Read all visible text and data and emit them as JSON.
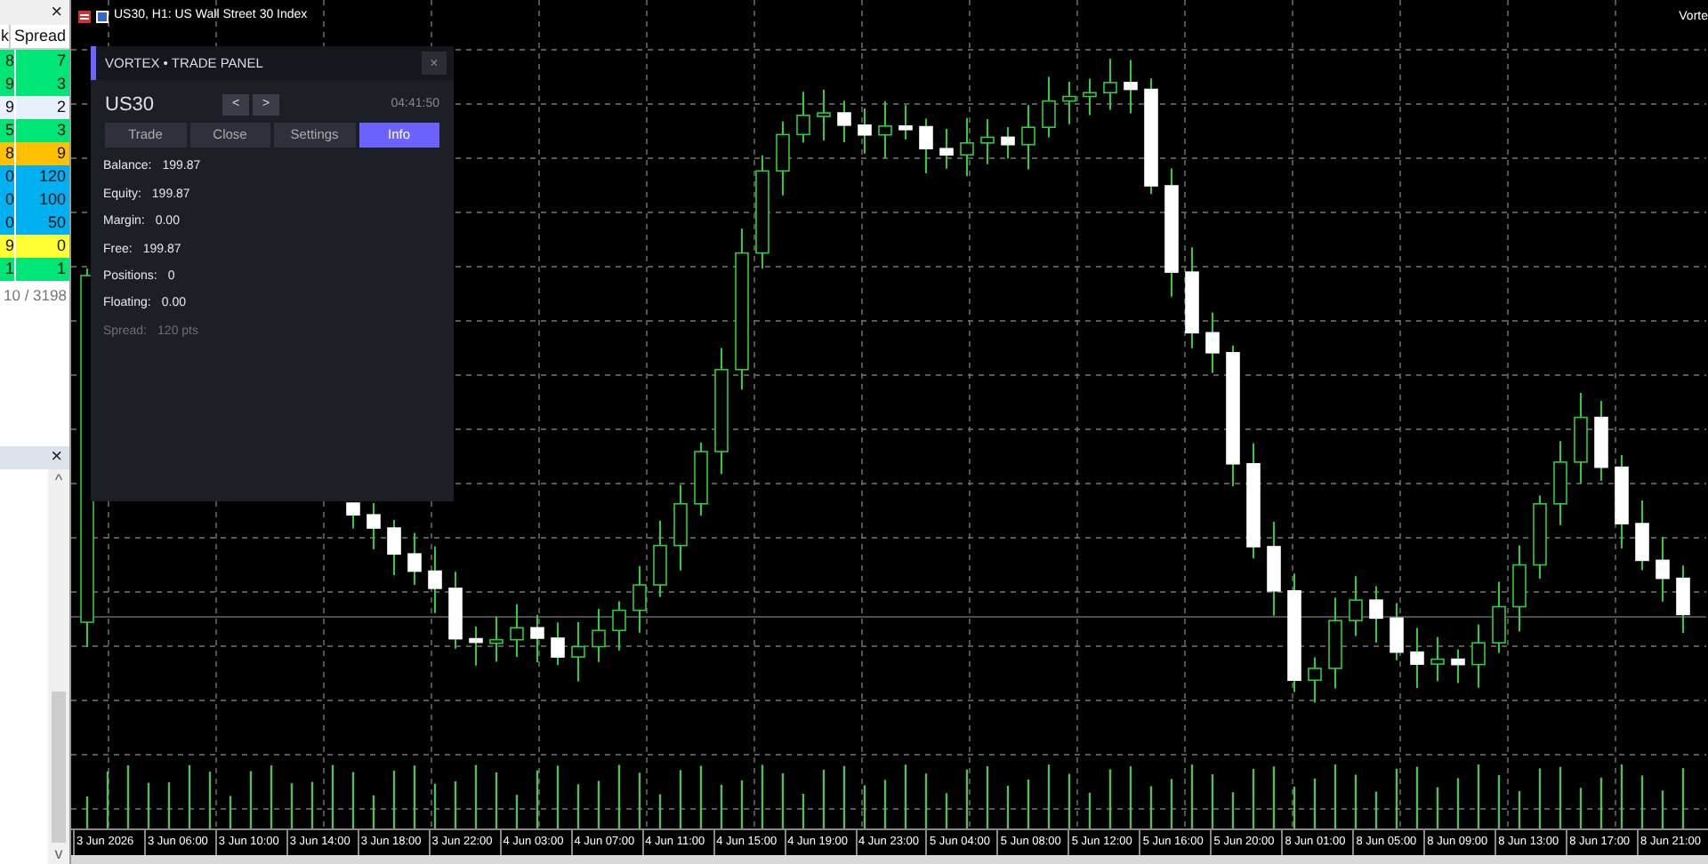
{
  "market_watch": {
    "close": "×",
    "columns": [
      "k",
      "Spread"
    ],
    "rows": [
      {
        "ask": "8",
        "spread": "7",
        "color": "#00e676"
      },
      {
        "ask": "9",
        "spread": "3",
        "color": "#00e676"
      },
      {
        "ask": "9",
        "spread": "2",
        "color": "#e8f0fb"
      },
      {
        "ask": "5",
        "spread": "3",
        "color": "#00e676"
      },
      {
        "ask": "8",
        "spread": "9",
        "color": "#ffc000"
      },
      {
        "ask": "0",
        "spread": "120",
        "color": "#00b0f0"
      },
      {
        "ask": "0",
        "spread": "100",
        "color": "#00b0f0"
      },
      {
        "ask": "0",
        "spread": "50",
        "color": "#00b0f0"
      },
      {
        "ask": "9",
        "spread": "0",
        "color": "#ffff33"
      },
      {
        "ask": "1",
        "spread": "1",
        "color": "#00e676"
      }
    ],
    "count": "10 / 3198"
  },
  "lower_panel": {
    "close": "×",
    "scroll_up": "^",
    "scroll_down": "v"
  },
  "chart": {
    "title": "US30, H1: US Wall Street 30 Index",
    "corner_label": "Vorte",
    "time_labels": [
      "3 Jun 2026",
      "3 Jun 06:00",
      "3 Jun 10:00",
      "3 Jun 14:00",
      "3 Jun 18:00",
      "3 Jun 22:00",
      "4 Jun 03:00",
      "4 Jun 07:00",
      "4 Jun 11:00",
      "4 Jun 15:00",
      "4 Jun 19:00",
      "4 Jun 23:00",
      "5 Jun 04:00",
      "5 Jun 08:00",
      "5 Jun 12:00",
      "5 Jun 16:00",
      "5 Jun 20:00",
      "8 Jun 01:00",
      "8 Jun 05:00",
      "8 Jun 09:00",
      "8 Jun 13:00",
      "8 Jun 17:00",
      "8 Jun 21:00"
    ]
  },
  "panel": {
    "title": "VORTEX • TRADE PANEL",
    "close": "×",
    "symbol": "US30",
    "prev": "<",
    "next": ">",
    "time": "04:41:50",
    "tabs": [
      {
        "label": "Trade",
        "selected": false
      },
      {
        "label": "Close",
        "selected": false
      },
      {
        "label": "Settings",
        "selected": false
      },
      {
        "label": "Info",
        "selected": true
      }
    ],
    "info": [
      {
        "label": "Balance:",
        "value": "199.87",
        "dim": false
      },
      {
        "label": "Equity:",
        "value": "199.87",
        "dim": false
      },
      {
        "label": "Margin:",
        "value": "0.00",
        "dim": false
      },
      {
        "label": "Free:",
        "value": "199.87",
        "dim": false
      },
      {
        "label": "Positions:",
        "value": "0",
        "dim": false
      },
      {
        "label": "Floating:",
        "value": "0.00",
        "dim": false
      },
      {
        "label": "Spread:",
        "value": "120 pts",
        "dim": true
      }
    ]
  }
}
